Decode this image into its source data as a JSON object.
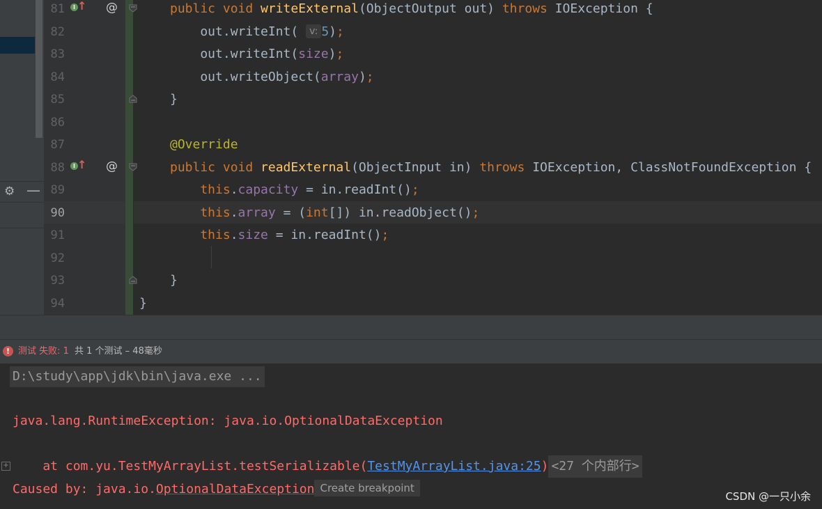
{
  "editor": {
    "lines": [
      {
        "num": "81",
        "tokens": [
          [
            "k",
            "public void "
          ],
          [
            "f",
            "writeExternal"
          ],
          [
            "p",
            "(ObjectOutput out) "
          ],
          [
            "k",
            "throws "
          ],
          [
            "p",
            "IOException {"
          ]
        ]
      },
      {
        "num": "82",
        "tokens": [
          [
            "p",
            "    out.writeInt( "
          ],
          [
            "hint",
            "v:"
          ],
          [
            "num",
            "5"
          ],
          [
            "p",
            ")"
          ],
          [
            "k",
            ";"
          ]
        ]
      },
      {
        "num": "83",
        "tokens": [
          [
            "p",
            "    out.writeInt("
          ],
          [
            "fld",
            "size"
          ],
          [
            "p",
            ")"
          ],
          [
            "k",
            ";"
          ]
        ]
      },
      {
        "num": "84",
        "tokens": [
          [
            "p",
            "    out.writeObject("
          ],
          [
            "fld",
            "array"
          ],
          [
            "p",
            ")"
          ],
          [
            "k",
            ";"
          ]
        ]
      },
      {
        "num": "85",
        "tokens": [
          [
            "p",
            "}"
          ]
        ]
      },
      {
        "num": "86",
        "tokens": []
      },
      {
        "num": "87",
        "tokens": [
          [
            "ann",
            "@Override"
          ]
        ]
      },
      {
        "num": "88",
        "tokens": [
          [
            "k",
            "public void "
          ],
          [
            "f",
            "readExternal"
          ],
          [
            "p",
            "(ObjectInput in) "
          ],
          [
            "k",
            "throws "
          ],
          [
            "p",
            "IOException, ClassNotFoundException {"
          ]
        ]
      },
      {
        "num": "89",
        "tokens": [
          [
            "k",
            "    this"
          ],
          [
            "p",
            "."
          ],
          [
            "fld",
            "capacity"
          ],
          [
            "p",
            " = in.readInt()"
          ],
          [
            "k",
            ";"
          ]
        ]
      },
      {
        "num": "90",
        "tokens": [
          [
            "k",
            "    this"
          ],
          [
            "p",
            "."
          ],
          [
            "fld",
            "array"
          ],
          [
            "p",
            " = ("
          ],
          [
            "k",
            "int"
          ],
          [
            "p",
            "[]) in.readObject()"
          ],
          [
            "k",
            ";"
          ]
        ]
      },
      {
        "num": "91",
        "tokens": [
          [
            "k",
            "    this"
          ],
          [
            "p",
            "."
          ],
          [
            "fld",
            "size"
          ],
          [
            "p",
            " = in.readInt()"
          ],
          [
            "k",
            ";"
          ]
        ]
      },
      {
        "num": "92",
        "tokens": []
      },
      {
        "num": "93",
        "tokens": [
          [
            "p",
            "}"
          ]
        ]
      },
      {
        "num": "94",
        "tokens": [
          [
            "p",
            "}"
          ]
        ]
      }
    ],
    "current_line": "90",
    "at_symbol": "@",
    "impl_letter": "I"
  },
  "status": {
    "icon": "!",
    "fail_text": "测试 失败: 1",
    "detail_text": "共 1 个测试 – 48毫秒"
  },
  "console": {
    "cmd": "D:\\study\\app\\jdk\\bin\\java.exe ...",
    "exception": "java.lang.RuntimeException: java.io.OptionalDataException",
    "at_prefix": "    at com.yu.TestMyArrayList.testSerializable(",
    "at_link": "TestMyArrayList.java:25",
    "at_suffix": ")",
    "folded": "<27 个内部行>",
    "caused_prefix": "Caused by: java.io.",
    "caused_link": "OptionalDataException",
    "popup": "Create breakpoint",
    "expand": "+"
  },
  "watermark": "CSDN @一只小余",
  "colors": {
    "keyword": "#cc7832",
    "method": "#ffc66d",
    "field": "#9876aa",
    "annotation": "#bbb529",
    "number": "#6897bb",
    "error": "#ff6b68",
    "link": "#5394ec"
  }
}
